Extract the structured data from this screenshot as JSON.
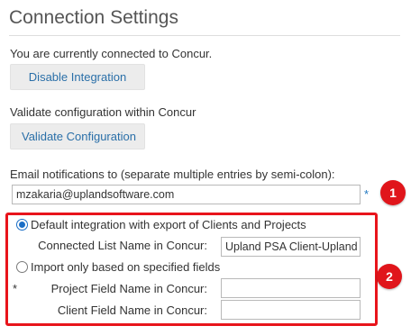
{
  "page": {
    "title": "Connection Settings",
    "status_text": "You are currently connected to Concur.",
    "disable_button": "Disable Integration",
    "validate_caption": "Validate configuration within Concur",
    "validate_button": "Validate Configuration",
    "email_label": "Email notifications to (separate multiple entries by semi-colon):",
    "email_value": "mzakaria@uplandsoftware.com",
    "required_mark": "*"
  },
  "options": {
    "default_label": "Default integration with export of Clients and Projects",
    "connected_list_label": "Connected List Name in Concur:",
    "connected_list_value": "Upland PSA Client-Upland PSA Project",
    "import_label": "Import only based on specified fields",
    "project_field_label": "Project Field Name in Concur:",
    "project_field_value": "",
    "client_field_label": "Client Field Name in Concur:",
    "client_field_value": "",
    "selected": "default"
  },
  "annotations": {
    "badge_1": "1",
    "badge_2": "2",
    "color": "#e0151b"
  }
}
